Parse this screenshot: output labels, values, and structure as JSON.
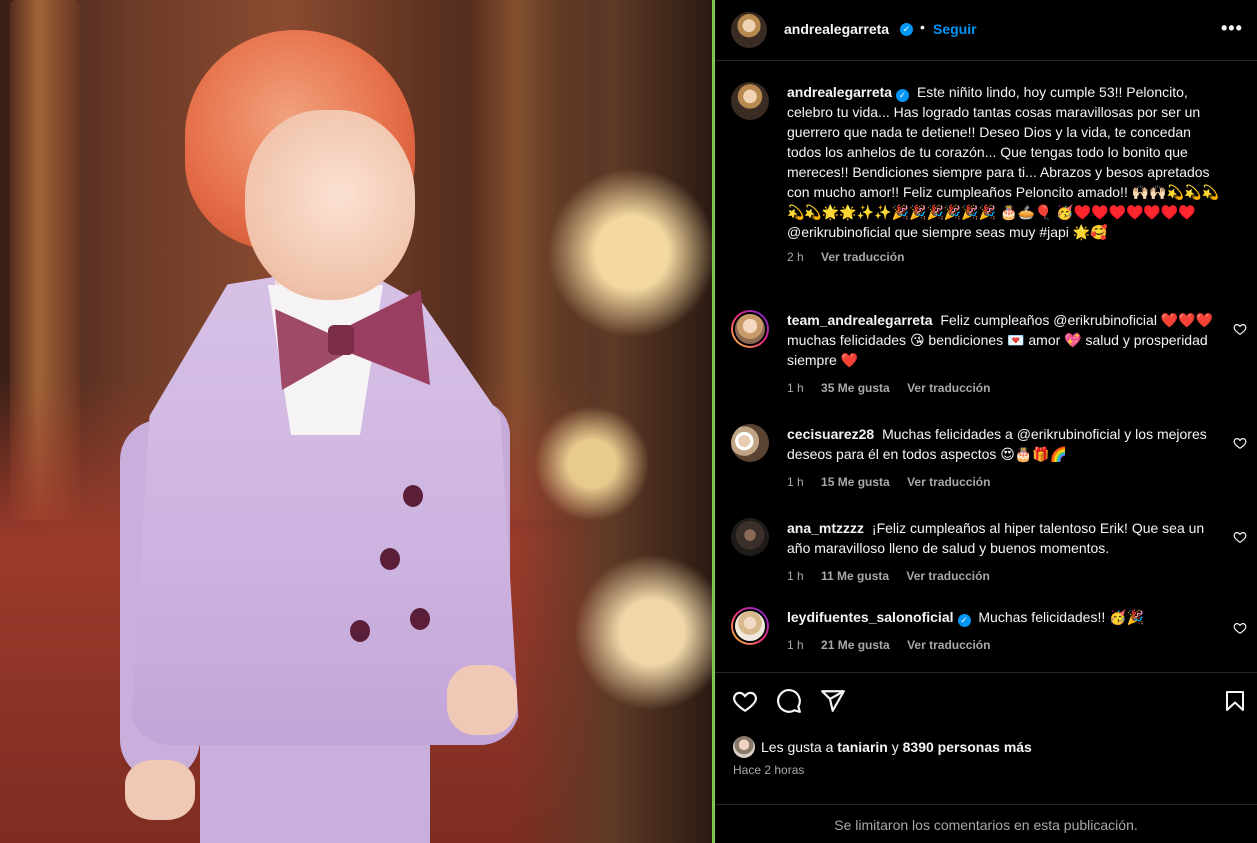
{
  "post": {
    "author": "andrealegarreta",
    "follow_label": "Seguir",
    "more_label": "•••",
    "dot": "•"
  },
  "caption": {
    "username": "andrealegarreta",
    "text": "Este niñito lindo, hoy cumple 53!! Peloncito, celebro tu vida... Has logrado tantas cosas maravillosas por ser un guerrero que nada te detiene!! Deseo Dios y la vida, te concedan todos los anhelos de tu corazón... Que tengas todo lo bonito que mereces!! Bendiciones siempre para ti... Abrazos y besos apretados con mucho amor!! Feliz cumpleaños Peloncito amado!! 🙌🏻🙌🏻💫💫💫💫💫🌟🌟✨✨🎉🎉🎉🎉🎉🎉 🎂🥧🎈 🥳♥️♥️♥️♥️♥️♥️♥️ @erikrubinoficial que siempre seas muy #japi 🌟🥰",
    "time": "2 h",
    "translate": "Ver traducción"
  },
  "comments": [
    {
      "username": "team_andrealegarreta",
      "text": "Feliz cumpleaños @erikrubinoficial ❤️❤️❤️ muchas felicidades 😘 bendiciones 💌 amor 💖 salud y prosperidad siempre ❤️",
      "time": "1 h",
      "likes": "35 Me gusta",
      "translate": "Ver traducción"
    },
    {
      "username": "cecisuarez28",
      "text": "Muchas felicidades a @erikrubinoficial y los mejores deseos para él en todos aspectos 😍🎂🎁🌈",
      "time": "1 h",
      "likes": "15 Me gusta",
      "translate": "Ver traducción"
    },
    {
      "username": "ana_mtzzzz",
      "text": "¡Feliz cumpleaños al hiper talentoso Erik! Que sea un año maravilloso lleno de salud y buenos momentos.",
      "time": "1 h",
      "likes": "11 Me gusta",
      "translate": "Ver traducción"
    },
    {
      "username": "leydifuentes_salonoficial",
      "text": "Muchas felicidades!! 🥳🎉",
      "time": "1 h",
      "likes": "21 Me gusta",
      "translate": "Ver traducción"
    }
  ],
  "likes_line": {
    "prefix": "Les gusta a",
    "user": "taniarin",
    "and": "y",
    "others": "8390 personas más"
  },
  "posted_ago": "Hace 2 horas",
  "comments_limited": "Se limitaron los comentarios en esta publicación.",
  "icons": {
    "like": "heart-icon",
    "comment": "comment-icon",
    "share": "share-icon",
    "save": "bookmark-icon",
    "verified": "verified-badge-icon"
  },
  "colors": {
    "accent": "#0095f6",
    "background": "#000000",
    "muted": "#a8a8a8"
  }
}
